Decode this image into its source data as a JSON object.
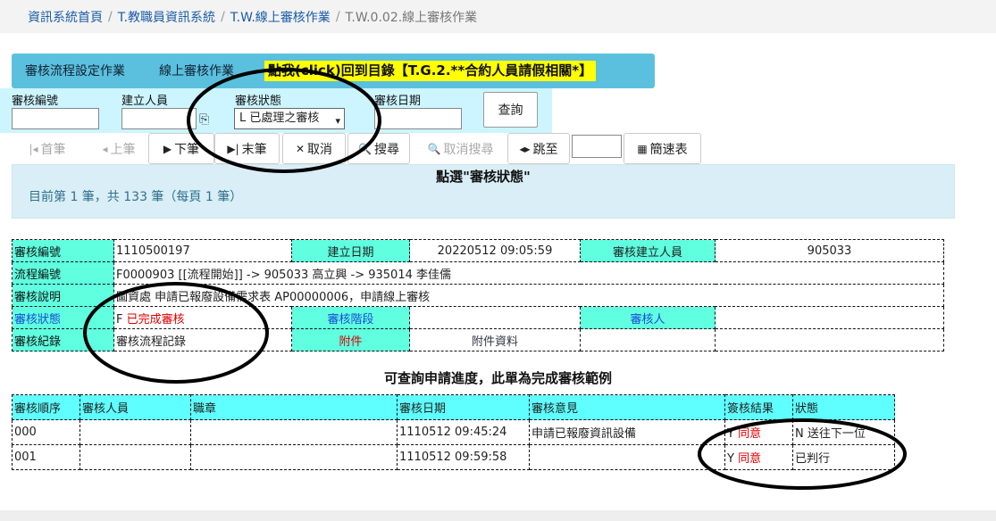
{
  "breadcrumb": [
    "資訊系統首頁",
    "T.教職員資訊系統",
    "T.W.線上審核作業",
    "T.W.0.02.線上審核作業"
  ],
  "tabs": {
    "flow_setting": "審核流程設定作業",
    "online_review": "線上審核作業",
    "back_to_menu": "點我(click)回到目錄【T.G.2.**合約人員請假相關*】"
  },
  "filter": {
    "label_no": "審核編號",
    "label_creator": "建立人員",
    "label_status": "審核狀態",
    "label_date": "審核日期",
    "status_selected": "L 已處理之審核",
    "query_button": "查詢"
  },
  "nav": {
    "first": "首筆",
    "prev": "上筆",
    "next": "下筆",
    "last": "末筆",
    "cancel": "取消",
    "search": "搜尋",
    "cancel_search": "取消搜尋",
    "jump": "跳至",
    "brief": "簡速表"
  },
  "info": {
    "hint": "點選\"審核狀態\"",
    "count": "目前第 1 筆，共 133 筆（每頁 1 筆）"
  },
  "detail": {
    "no_label": "審核編號",
    "no_value": "1110500197",
    "create_date_label": "建立日期",
    "create_date_value": "20220512 09:05:59",
    "creator_label": "審核建立人員",
    "creator_value": "905033",
    "flow_label": "流程編號",
    "flow_value": "F0000903 [[流程開始]] -> 905033 高立興 -> 935014 李佳儒",
    "desc_label": "審核說明",
    "desc_value": "圖資處 申請已報廢設備需求表 AP00000006，申請線上審核",
    "status_label": "審核狀態",
    "status_code": "F",
    "status_value": "已完成審核",
    "stage_label": "審核階段",
    "reviewer_label": "審核人",
    "record_label": "審核紀錄",
    "record_value": "審核流程記錄",
    "attach_label": "附件",
    "attach_value": "附件資料"
  },
  "caption": "可查詢申請進度，此單為完成審核範例",
  "history": {
    "headers": [
      "審核順序",
      "審核人員",
      "職章",
      "審核日期",
      "審核意見",
      "簽核結果",
      "狀態"
    ],
    "rows": [
      {
        "order": "000",
        "date": "1110512 09:45:24",
        "opinion": "申請已報廢資訊設備",
        "result_code": "Y",
        "result": "同意",
        "state": "N 送往下一位"
      },
      {
        "order": "001",
        "date": "1110512 09:59:58",
        "opinion": "",
        "result_code": "Y",
        "result": "同意",
        "state": "已判行"
      }
    ]
  }
}
